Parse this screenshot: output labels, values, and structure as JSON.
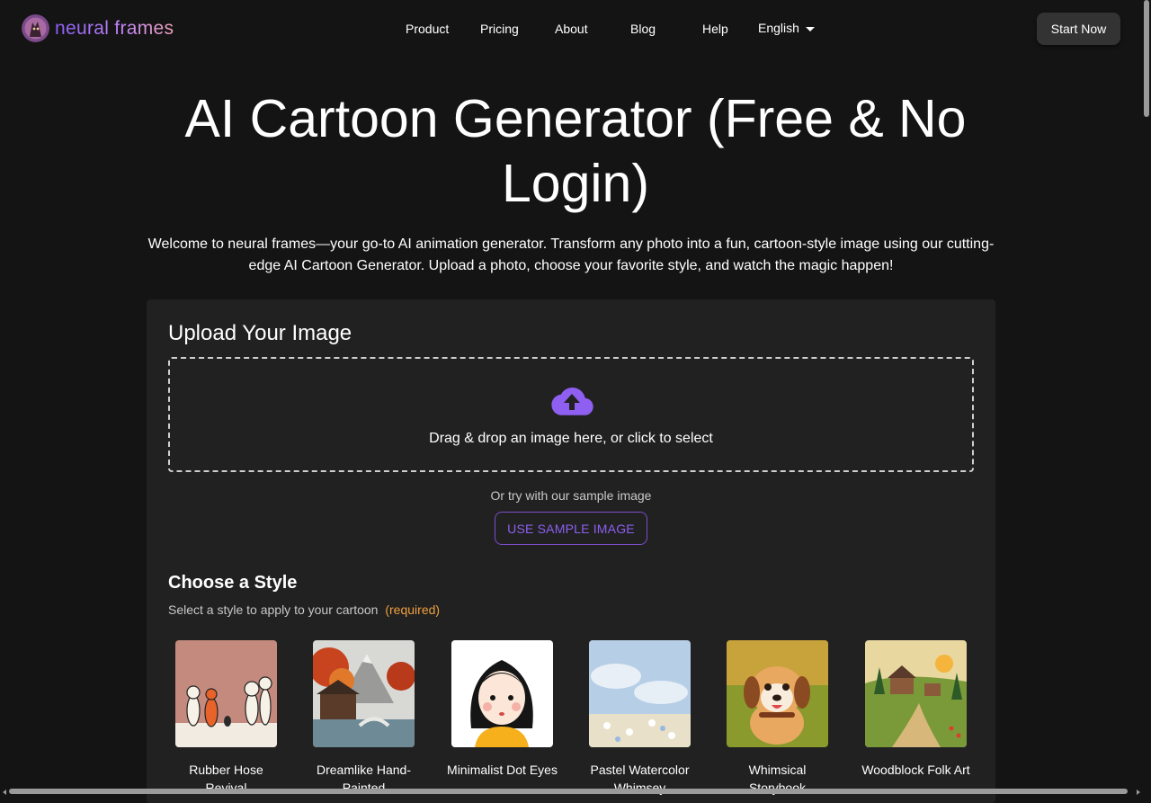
{
  "header": {
    "brand": "neural frames",
    "nav": [
      "Product",
      "Pricing",
      "About",
      "Blog",
      "Help"
    ],
    "language": "English",
    "cta": "Start Now"
  },
  "hero": {
    "title": "AI Cartoon Generator (Free & No Login)",
    "description": "Welcome to neural frames—your go-to AI animation generator. Transform any photo into a fun, cartoon-style image using our cutting-edge AI Cartoon Generator. Upload a photo, choose your favorite style, and watch the magic happen!"
  },
  "upload": {
    "title": "Upload Your Image",
    "drop_text": "Drag & drop an image here, or click to select",
    "icon": "cloud-upload-icon",
    "sample_hint": "Or try with our sample image",
    "sample_button": "USE SAMPLE IMAGE"
  },
  "styles": {
    "title": "Choose a Style",
    "subtitle": "Select a style to apply to your cartoon",
    "required": "(required)",
    "items": [
      {
        "name": "Rubber Hose Revival"
      },
      {
        "name": "Dreamlike Hand-Painted"
      },
      {
        "name": "Minimalist Dot Eyes"
      },
      {
        "name": "Pastel Watercolor Whimsey"
      },
      {
        "name": "Whimsical Storybook"
      },
      {
        "name": "Woodblock Folk Art"
      }
    ]
  },
  "colors": {
    "background": "#141414",
    "card": "#212121",
    "accent": "#8e5ff0",
    "required": "#f0a040"
  }
}
